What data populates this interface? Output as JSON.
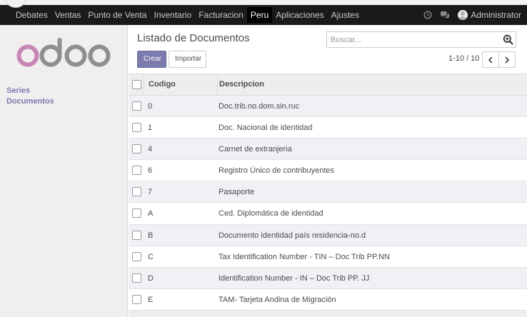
{
  "navbar": {
    "menu": [
      {
        "label": "Debates",
        "active": false
      },
      {
        "label": "Ventas",
        "active": false
      },
      {
        "label": "Punto de Venta",
        "active": false
      },
      {
        "label": "Inventario",
        "active": false
      },
      {
        "label": "Facturacion",
        "active": false
      },
      {
        "label": "Peru",
        "active": true
      },
      {
        "label": "Aplicaciones",
        "active": false
      },
      {
        "label": "Ajustes",
        "active": false
      }
    ],
    "user_name": "Administrator",
    "icons": [
      "clock-icon",
      "chat-icon",
      "avatar"
    ]
  },
  "sidebar": {
    "logo_text": "odoo",
    "links": [
      "Series",
      "Documentos"
    ]
  },
  "control_panel": {
    "title": "Listado de Documentos",
    "search_placeholder": "Buscar...",
    "create_label": "Crear",
    "import_label": "Importar",
    "pager_value": "1-10 / 10"
  },
  "table": {
    "columns": [
      "Codigo",
      "Descripcion"
    ],
    "rows": [
      {
        "code": "0",
        "description": "Doc.trib.no.dom.sin.ruc"
      },
      {
        "code": "1",
        "description": "Doc. Nacional de identidad"
      },
      {
        "code": "4",
        "description": "Carnet de extranjeria"
      },
      {
        "code": "6",
        "description": "Registro Único de contribuyentes"
      },
      {
        "code": "7",
        "description": "Pasaporte"
      },
      {
        "code": "A",
        "description": "Ced. Diplomática de identidad"
      },
      {
        "code": "B",
        "description": "Documento identidad país residencia-no.d"
      },
      {
        "code": "C",
        "description": "Tax Identification Number - TIN – Doc Trib PP.NN"
      },
      {
        "code": "D",
        "description": "Identification Number - IN – Doc Trib PP. JJ"
      },
      {
        "code": "E",
        "description": "TAM- Tarjeta Andina de Migración"
      }
    ]
  },
  "colors": {
    "navbar_bg": "#1a1a1a",
    "brand": "#7c7bad",
    "logo_o": "#c786b4",
    "logo_doo": "#8f8f8f"
  }
}
